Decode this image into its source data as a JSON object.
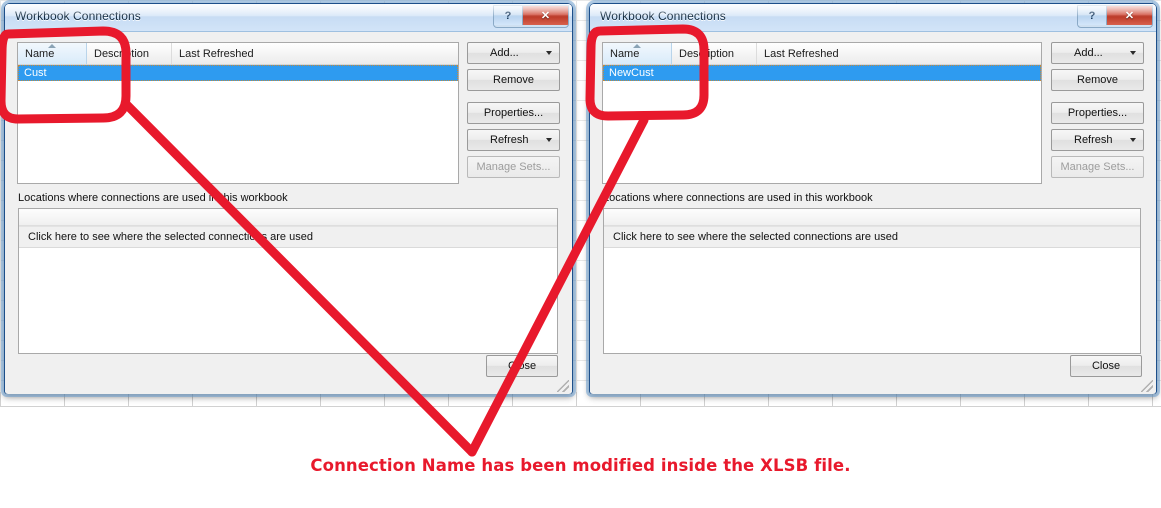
{
  "dialogs": [
    {
      "id": "left",
      "title": "Workbook Connections",
      "caption_buttons": {
        "help": "?",
        "close": "✕"
      },
      "columns": [
        "Name",
        "Description",
        "Last Refreshed"
      ],
      "rows": [
        {
          "name": "Cust",
          "description": "",
          "last_refreshed": "",
          "selected": true
        }
      ],
      "buttons": [
        {
          "label": "Add...",
          "accel": "d",
          "split": true,
          "disabled": false
        },
        {
          "label": "Remove",
          "accel": "m",
          "split": false,
          "disabled": false
        },
        {
          "label": "Properties...",
          "accel": "P",
          "split": false,
          "disabled": false
        },
        {
          "label": "Refresh",
          "accel": "R",
          "split": true,
          "disabled": false
        },
        {
          "label": "Manage Sets...",
          "accel": "",
          "split": false,
          "disabled": true
        }
      ],
      "locations_label": "Locations where connections are used in this workbook",
      "locations_row": "Click here to see where the selected connections are used",
      "close_label": "Close"
    },
    {
      "id": "right",
      "title": "Workbook Connections",
      "caption_buttons": {
        "help": "?",
        "close": "✕"
      },
      "columns": [
        "Name",
        "Description",
        "Last Refreshed"
      ],
      "rows": [
        {
          "name": "NewCust",
          "description": "",
          "last_refreshed": "",
          "selected": true
        }
      ],
      "buttons": [
        {
          "label": "Add...",
          "accel": "d",
          "split": true,
          "disabled": false
        },
        {
          "label": "Remove",
          "accel": "m",
          "split": false,
          "disabled": false
        },
        {
          "label": "Properties...",
          "accel": "P",
          "split": false,
          "disabled": false
        },
        {
          "label": "Refresh",
          "accel": "R",
          "split": true,
          "disabled": false
        },
        {
          "label": "Manage Sets...",
          "accel": "",
          "split": false,
          "disabled": true
        }
      ],
      "locations_label": "Locations where connections are used in this workbook",
      "locations_row": "Click here to see where the selected connections are used",
      "close_label": "Close"
    }
  ],
  "annotation": {
    "caption": "Connection Name has been modified inside the XLSB file.",
    "color": "#e8192c",
    "highlight_shape": "rounded-rectangle",
    "pointer_shape": "v-arrow"
  }
}
